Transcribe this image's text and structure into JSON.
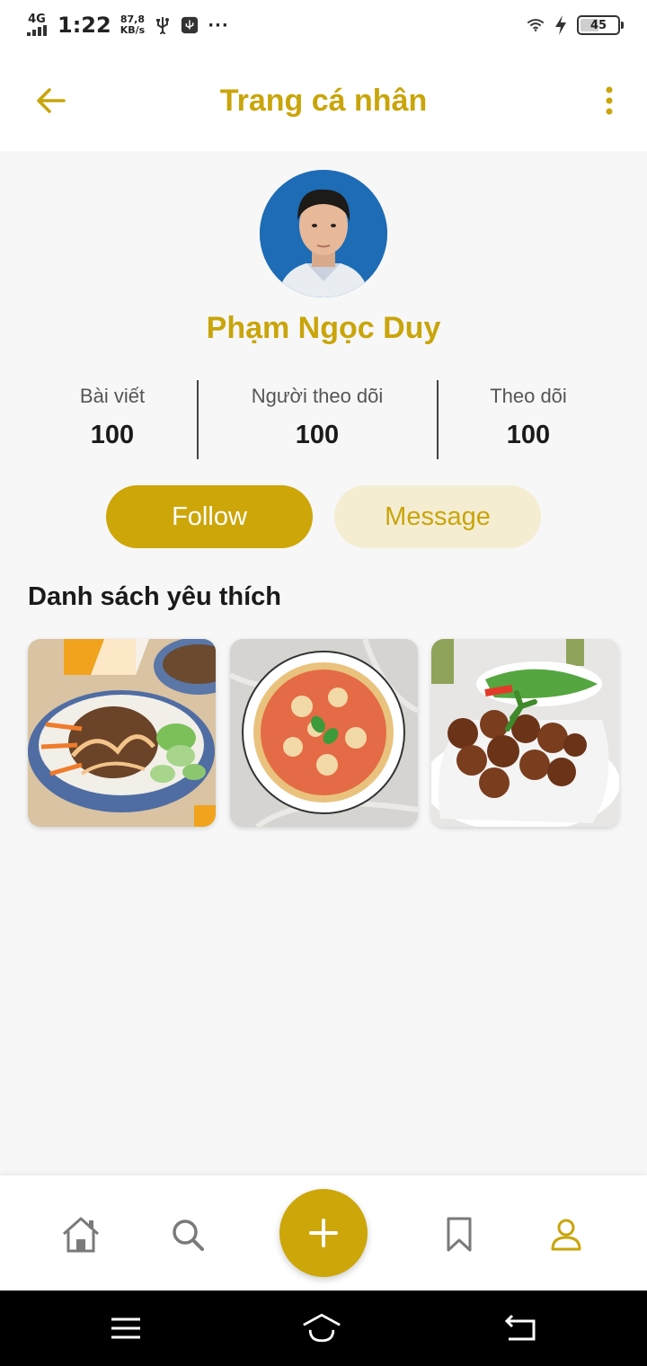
{
  "status_bar": {
    "network": "4G",
    "time": "1:22",
    "speed_value": "87,8",
    "speed_unit": "KB/s",
    "more": "···",
    "battery": "45",
    "battery_level": 0.45
  },
  "app_bar": {
    "title": "Trang cá nhân",
    "back_icon": "arrow-left-icon",
    "menu_icon": "more-vertical-icon"
  },
  "profile": {
    "name": "Phạm Ngọc Duy",
    "avatar_icon": "user-avatar"
  },
  "stats": [
    {
      "label": "Bài viết",
      "value": "100"
    },
    {
      "label": "Người theo dõi",
      "value": "100"
    },
    {
      "label": "Theo dõi",
      "value": "100"
    }
  ],
  "actions": {
    "follow": "Follow",
    "message": "Message"
  },
  "favorites": {
    "title": "Danh sách yêu thích",
    "items": [
      {
        "name": "rice-bowl"
      },
      {
        "name": "pizza"
      },
      {
        "name": "meatballs"
      }
    ]
  },
  "bottom_nav": {
    "items": [
      "home-icon",
      "search-icon",
      "plus-icon",
      "bookmark-icon",
      "profile-icon"
    ],
    "active": "profile-icon"
  },
  "colors": {
    "accent": "#cda60a",
    "accent_text": "#c9a50a",
    "accent_soft": "#f4edd2",
    "background": "#f7f7f7"
  }
}
